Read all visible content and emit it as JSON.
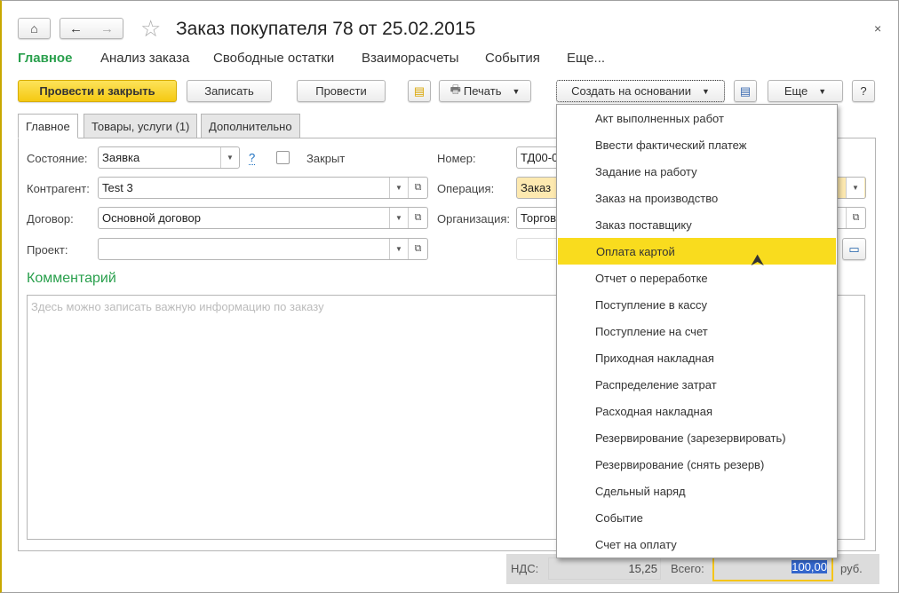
{
  "window": {
    "title": "Заказ покупателя 78 от 25.02.2015",
    "close": "×"
  },
  "nav": [
    "Главное",
    "Анализ заказа",
    "Свободные остатки",
    "Взаиморасчеты",
    "События",
    "Еще..."
  ],
  "toolbar": {
    "post_close": "Провести и закрыть",
    "save": "Записать",
    "post": "Провести",
    "print": "Печать",
    "create_based": "Создать на основании",
    "more": "Еще",
    "help": "?"
  },
  "tabs": [
    "Главное",
    "Товары, услуги (1)",
    "Дополнительно"
  ],
  "form": {
    "state_label": "Состояние:",
    "state_value": "Заявка",
    "help_link": "?",
    "closed_label": "Закрыт",
    "contractor_label": "Контрагент:",
    "contractor_value": "Test 3",
    "contract_label": "Договор:",
    "contract_value": "Основной договор",
    "project_label": "Проект:",
    "project_value": "",
    "number_label": "Номер:",
    "number_value": "ТД00-0",
    "operation_label": "Операция:",
    "operation_value": "Заказ",
    "org_label": "Организация:",
    "org_value": "Торгов",
    "comment_title": "Комментарий",
    "comment_placeholder": "Здесь можно записать важную информацию по заказу"
  },
  "totals": {
    "vat_label": "НДС:",
    "vat_value": "15,25",
    "total_label": "Всего:",
    "total_value": "100,00",
    "currency": "руб."
  },
  "menu": {
    "highlighted": 5,
    "items": [
      "Акт выполненных работ",
      "Ввести фактический платеж",
      "Задание на работу",
      "Заказ на производство",
      "Заказ поставщику",
      "Оплата картой",
      "Отчет о переработке",
      "Поступление в кассу",
      "Поступление на счет",
      "Приходная накладная",
      "Распределение затрат",
      "Расходная накладная",
      "Резервирование (зарезервировать)",
      "Резервирование (снять резерв)",
      "Сдельный наряд",
      "Событие",
      "Счет на оплату"
    ]
  }
}
